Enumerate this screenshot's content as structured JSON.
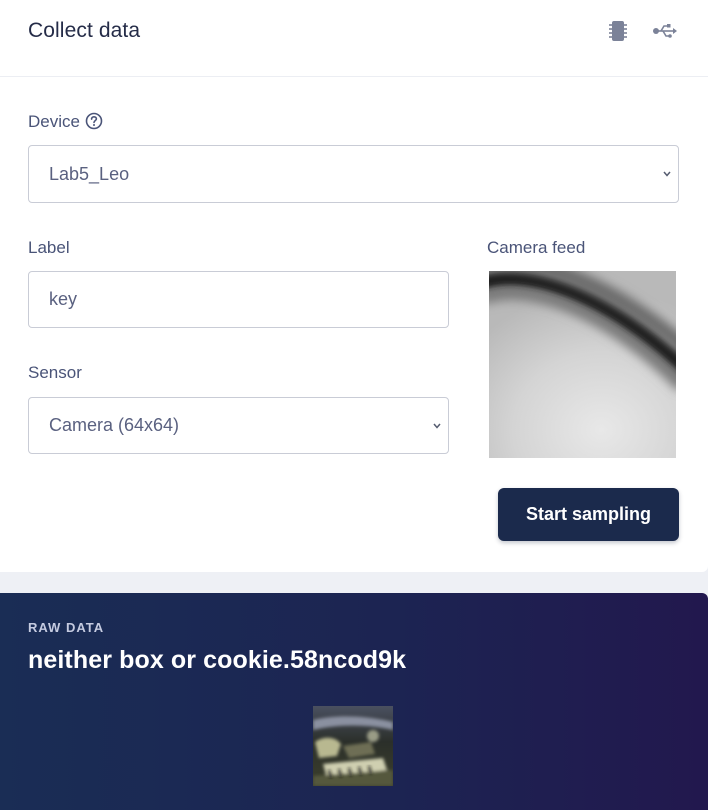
{
  "header": {
    "title": "Collect data",
    "icons": [
      "chip-icon",
      "usb-icon"
    ]
  },
  "device": {
    "label": "Device",
    "help_icon": "question-circle-icon",
    "selected": "Lab5_Leo"
  },
  "label_field": {
    "label": "Label",
    "value": "key"
  },
  "sensor": {
    "label": "Sensor",
    "selected": "Camera (64x64)"
  },
  "camera": {
    "label": "Camera feed"
  },
  "actions": {
    "start_label": "Start sampling"
  },
  "raw_data": {
    "caption": "RAW DATA",
    "title": "neither box or cookie.58ncod9k"
  },
  "colors": {
    "primary_button": "#1b2a4c",
    "raw_panel_start": "#1a2d55",
    "raw_panel_end": "#22184e",
    "text_dark": "#252c48",
    "label_text": "#4a5478"
  }
}
